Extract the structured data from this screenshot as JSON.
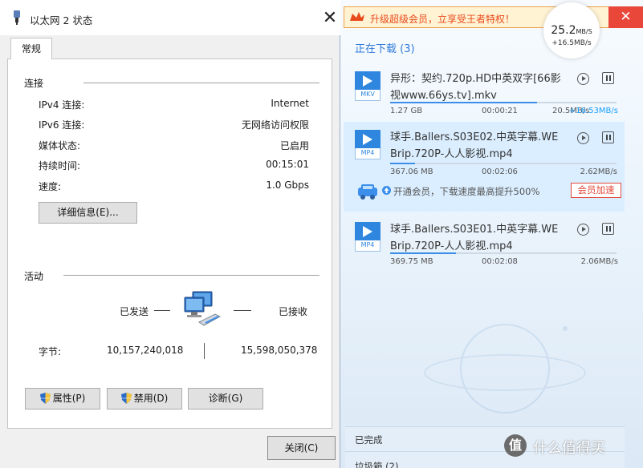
{
  "window": {
    "title": "以太网 2 状态",
    "close_glyph": "✕",
    "tab": "常规",
    "connection": {
      "heading": "连接",
      "rows": [
        {
          "label": "IPv4 连接:",
          "value": "Internet"
        },
        {
          "label": "IPv6 连接:",
          "value": "无网络访问权限"
        },
        {
          "label": "媒体状态:",
          "value": "已启用"
        },
        {
          "label": "持续时间:",
          "value": "00:15:01"
        },
        {
          "label": "速度:",
          "value": "1.0 Gbps"
        }
      ],
      "details_button": "详细信息(E)..."
    },
    "activity": {
      "heading": "活动",
      "sent_label": "已发送",
      "received_label": "已接收",
      "bytes_label": "字节:",
      "bytes_sent": "10,157,240,018",
      "bytes_received": "15,598,050,378"
    },
    "buttons": {
      "properties": "属性(P)",
      "disable": "禁用(D)",
      "diagnose": "诊断(G)",
      "close": "关闭(C)"
    }
  },
  "downloader": {
    "promo_text": "升级超级会员，立享受王者特权！",
    "close_glyph": "✕",
    "speed": {
      "value": "25.2",
      "unit": "MB/S",
      "extra": "+16.5MB/s"
    },
    "section_downloading": "正在下载 (3)",
    "items": [
      {
        "ext": "MKV",
        "name": "异形：契约.720p.HD中英双字[66影视www.66ys.tv].mkv",
        "size": "1.27 GB",
        "time": "00:00:21",
        "speed": "20.5MB/s",
        "boost": "+16.53MB/s",
        "progress": 0.65
      },
      {
        "ext": "MP4",
        "name": "球手.Ballers.S03E02.中英字幕.WEBrip.720P-人人影视.mp4",
        "size": "367.06 MB",
        "time": "00:02:06",
        "speed": "2.62MB/s",
        "boost": "",
        "progress": 0.11
      },
      {
        "ext": "MP4",
        "name": "球手.Ballers.S03E01.中英字幕.WEBrip.720P-人人影视.mp4",
        "size": "369.75 MB",
        "time": "00:02:08",
        "speed": "2.06MB/s",
        "boost": "",
        "progress": 0.29
      }
    ],
    "vip_text": "开通会员，下载速度最高提升500%",
    "vip_button": "会员加速",
    "section_completed": "已完成",
    "section_trash": "垃圾箱 (2)",
    "watermark": "什么值得买",
    "colors": {
      "accent": "#2f7ad8",
      "progress": "#3b8eea",
      "boost": "#1aa1ff",
      "vip": "#e24a3b"
    }
  }
}
